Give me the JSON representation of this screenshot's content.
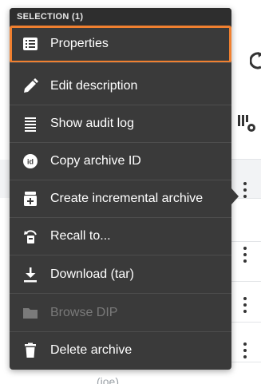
{
  "menu": {
    "header": "SELECTION (1)",
    "items": [
      {
        "label": "Properties",
        "icon": "list-alt-icon",
        "state": "selected"
      },
      {
        "label": "Edit description",
        "icon": "pencil-icon",
        "state": "enabled"
      },
      {
        "label": "Show audit log",
        "icon": "lines-icon",
        "state": "enabled"
      },
      {
        "label": "Copy archive ID",
        "icon": "id-badge-icon",
        "state": "enabled"
      },
      {
        "label": "Create incremental archive",
        "icon": "archive-plus-icon",
        "state": "enabled"
      },
      {
        "label": "Recall to...",
        "icon": "recall-icon",
        "state": "enabled"
      },
      {
        "label": "Download (tar)",
        "icon": "download-icon",
        "state": "enabled"
      },
      {
        "label": "Browse DIP",
        "icon": "folder-icon",
        "state": "disabled"
      },
      {
        "label": "Delete archive",
        "icon": "trash-icon",
        "state": "enabled"
      }
    ]
  },
  "background": {
    "partial_text": "(ioe)"
  },
  "colors": {
    "menu_bg": "#3a3a3a",
    "menu_header_bg": "#2e2e2e",
    "highlight": "#f08030",
    "disabled_text": "#7a7a7a"
  }
}
